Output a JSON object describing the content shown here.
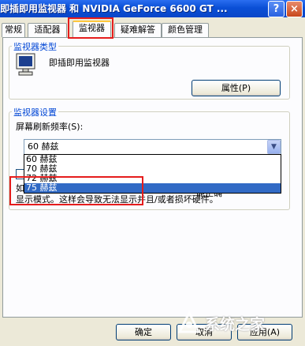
{
  "window": {
    "title": "即插即用监视器 和 NVIDIA GeForce 6600 GT ...",
    "help_glyph": "?",
    "close_glyph": "×"
  },
  "tabs": [
    "常规",
    "适配器",
    "监视器",
    "疑难解答",
    "颜色管理"
  ],
  "active_tab": "监视器",
  "monitor_type": {
    "group_label": "监视器类型",
    "monitor_name": "即插即用监视器",
    "properties_button": "属性(P)"
  },
  "monitor_settings": {
    "group_label": "监视器设置",
    "refresh_label": "屏幕刷新频率(S):",
    "selected_value": "60 赫兹",
    "options": [
      "60 赫兹",
      "70 赫兹",
      "72 赫兹",
      "75 赫兹"
    ],
    "highlighted_option": "75 赫兹",
    "hide_modes_checkbox": false,
    "warning_line1_start": "如",
    "warning_line1_end": "能正确",
    "warning_line2": "显示模式。这样会导致无法显示并且/或者损坏硬件。"
  },
  "footer": {
    "ok_button": "确定",
    "cancel_button": "取消",
    "apply_button": "应用(A)"
  },
  "watermark": "系统之家",
  "colors": {
    "titlebar": "#0a4fd6",
    "dialog_bg": "#ece9d8",
    "selection": "#316ac5",
    "highlight_box": "#e51c1c",
    "active_tab_accent": "#ffc83c"
  }
}
